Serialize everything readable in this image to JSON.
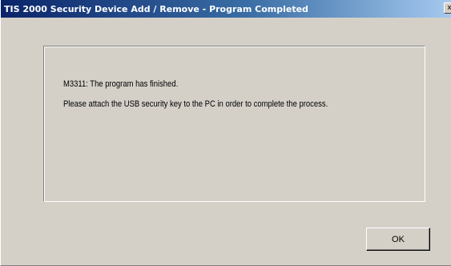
{
  "window": {
    "title": "TIS 2000 Security Device Add / Remove   -   Program Completed",
    "close_glyph": "x"
  },
  "message": {
    "line1": "M3311: The program has finished.",
    "line2": "Please attach the USB security key to the PC in order to complete the process."
  },
  "buttons": {
    "ok_label": "OK"
  },
  "colors": {
    "title_bar_start": "#0a246a",
    "title_bar_end": "#a6caf0",
    "dialog_background": "#d4d0c8"
  },
  "icons": {
    "close": "close-icon"
  }
}
